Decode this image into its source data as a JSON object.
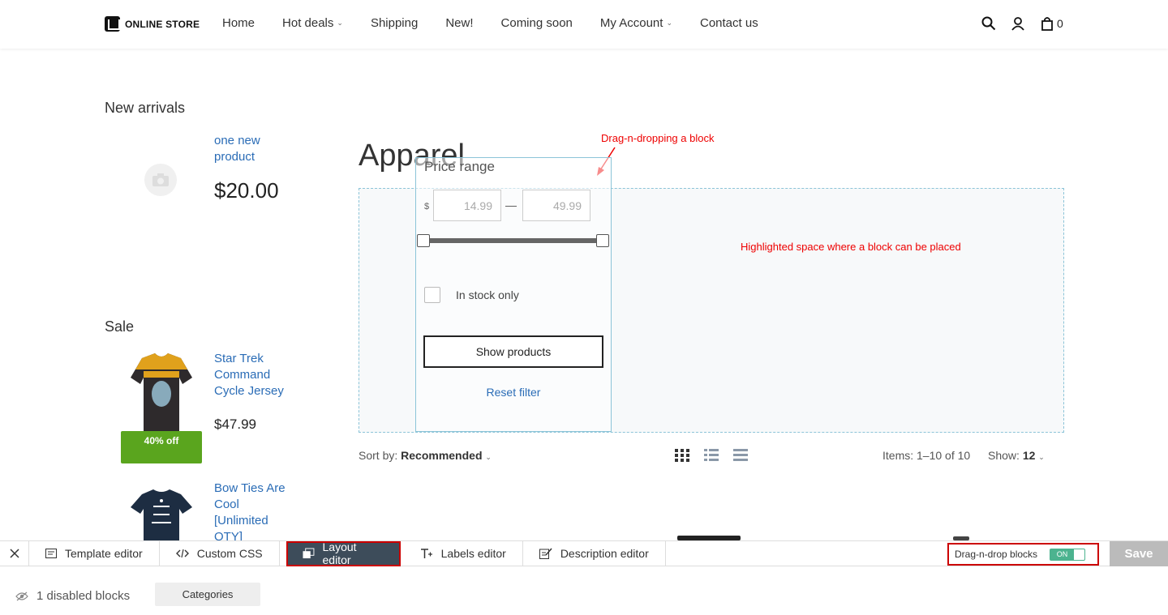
{
  "header": {
    "logo_text": "ONLINE STORE",
    "nav": [
      {
        "label": "Home",
        "dropdown": false
      },
      {
        "label": "Hot deals",
        "dropdown": true
      },
      {
        "label": "Shipping",
        "dropdown": false
      },
      {
        "label": "New!",
        "dropdown": false
      },
      {
        "label": "Coming soon",
        "dropdown": false
      },
      {
        "label": "My Account",
        "dropdown": true
      },
      {
        "label": "Contact us",
        "dropdown": false
      }
    ],
    "icons": [
      "search-icon",
      "account-icon",
      "cart-icon"
    ],
    "cart_count": "0"
  },
  "sidebar": {
    "new_arrivals_title": "New arrivals",
    "new_product": {
      "name": "one new product",
      "price": "$20.00",
      "icon": "camera-icon"
    },
    "sale_title": "Sale",
    "sale_products": [
      {
        "name": "Star Trek Command Cycle Jersey",
        "price": "$47.99",
        "badge": "40% off"
      },
      {
        "name": "Bow Ties Are Cool [Unlimited QTY]"
      }
    ]
  },
  "main": {
    "heading": "Apparel",
    "annotations": {
      "dragging": "Drag-n-dropping a block",
      "highlight": "Highlighted space where a block can be placed"
    },
    "filter": {
      "title": "Price range",
      "currency": "$",
      "min": "14.99",
      "max": "49.99",
      "dash": "—",
      "in_stock_label": "In stock only",
      "show_button": "Show products",
      "reset_link": "Reset filter"
    },
    "sort": {
      "label": "Sort by:",
      "value": "Recommended",
      "items_info": "Items: 1–10 of 10",
      "show_label": "Show:",
      "show_value": "12"
    }
  },
  "editor": {
    "tabs": [
      {
        "label": "Template editor",
        "icon": "template-icon",
        "active": false
      },
      {
        "label": "Custom CSS",
        "icon": "code-icon",
        "active": false
      },
      {
        "label": "Layout editor",
        "icon": "layout-icon",
        "active": true
      },
      {
        "label": "Labels editor",
        "icon": "text-icon",
        "active": false
      },
      {
        "label": "Description editor",
        "icon": "edit-icon",
        "active": false
      }
    ],
    "dnd_label": "Drag-n-drop blocks",
    "dnd_state": "ON",
    "save": "Save",
    "disabled_blocks": "1 disabled blocks",
    "categories_button": "Categories"
  }
}
